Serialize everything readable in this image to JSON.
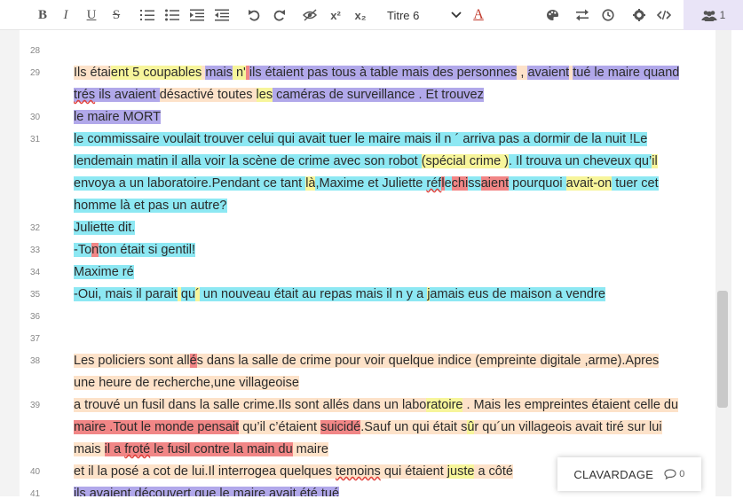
{
  "toolbar": {
    "bold_label": "B",
    "italic_label": "I",
    "underline_label": "U",
    "strike_label": "S",
    "superscript_label": "x²",
    "subscript_label": "x₂",
    "heading_select": {
      "value": "Titre 6"
    },
    "font_color_label": "A",
    "font_color": "#c0392b",
    "users_count": "1"
  },
  "gutter": {
    "line_numbers": [
      "28",
      "29",
      "30",
      "31",
      "32",
      "33",
      "34",
      "35",
      "36",
      "37",
      "38",
      "39",
      "40",
      "41"
    ]
  },
  "editor": {
    "lines": [
      {
        "segments": []
      },
      {
        "segments": [
          {
            "t": "Ils étai",
            "h": "p"
          },
          {
            "t": "ent 5 coupables",
            "h": "y"
          },
          {
            "t": " ",
            "h": "p"
          },
          {
            "t": "mais",
            "h": "v"
          },
          {
            "t": " n'",
            "h": "y"
          },
          {
            "t": " ",
            "h": "r"
          },
          {
            "t": "ils étaient pas tous à table mais des personnes",
            "h": "v"
          },
          {
            "t": " , ",
            "h": "p"
          },
          {
            "t": "avaient",
            "h": "v"
          },
          {
            "t": " ",
            "h": "p"
          },
          {
            "t": "tué le maire quand",
            "h": "v"
          }
        ]
      },
      {
        "segments": [
          {
            "t": "trés",
            "h": "v",
            "sp": true
          },
          {
            "t": " ils avaient ",
            "h": "v"
          },
          {
            "t": " désactivé toutes ",
            "h": "p"
          },
          {
            "t": "les",
            "h": "y"
          },
          {
            "t": " caméras de surveillance . Et trouvez",
            "h": "v"
          }
        ]
      },
      {
        "segments": [
          {
            "t": "le maire MORT",
            "h": "v"
          }
        ]
      },
      {
        "segments": [
          {
            "t": "le commissaire voulait trouver celui qui avait tuer le maire mais il n ´ arriva pas a dormir de la nuit !Le",
            "h": "c"
          }
        ]
      },
      {
        "segments": [
          {
            "t": "lendemain matin il alla voir la scène de crime avec son robot ",
            "h": "c"
          },
          {
            "t": "(spécial crime )",
            "h": "y"
          },
          {
            "t": ". Il trouva un cheveux qu’",
            "h": "c"
          },
          {
            "t": "il",
            "h": "y"
          }
        ]
      },
      {
        "segments": [
          {
            "t": "envoya a un  laboratoire.Pendant ce tant ",
            "h": "c"
          },
          {
            "t": "là",
            "h": "y"
          },
          {
            "t": ",Maxime et Juliette ",
            "h": "c"
          },
          {
            "t": "réf",
            "h": "c",
            "sp": true
          },
          {
            "t": "l",
            "h": "r"
          },
          {
            "t": "e",
            "h": "c"
          },
          {
            "t": "chi",
            "h": "r"
          },
          {
            "t": "ss",
            "h": "c"
          },
          {
            "t": "aient",
            "h": "r"
          },
          {
            "t": " pourquoi ",
            "h": "c"
          },
          {
            "t": "avait-on",
            "h": "y"
          },
          {
            "t": " tuer cet",
            "h": "c"
          }
        ]
      },
      {
        "segments": [
          {
            "t": "homme là et pas un autre?",
            "h": "c"
          }
        ]
      },
      {
        "segments": [
          {
            "t": "Juliette dit.",
            "h": "c"
          }
        ]
      },
      {
        "segments": [
          {
            "t": "-To",
            "h": "c"
          },
          {
            "t": "n",
            "h": "r"
          },
          {
            "t": "ton  était si gentil!",
            "h": "c"
          }
        ]
      },
      {
        "segments": [
          {
            "t": "Maxime ré",
            "h": "c"
          }
        ]
      },
      {
        "segments": [
          {
            "t": " -Oui, mais il parait",
            "h": "c"
          },
          {
            "t": " ",
            "h": "y"
          },
          {
            "t": "qu",
            "h": "c"
          },
          {
            "t": "´",
            "h": "y"
          },
          {
            "t": " un nouveau était au repas mais il n y a ",
            "h": "c"
          },
          {
            "t": "j",
            "h": "y"
          },
          {
            "t": "amais eus de maison a vendre",
            "h": "c"
          }
        ]
      },
      {
        "segments": []
      },
      {
        "segments": []
      },
      {
        "segments": [
          {
            "t": "Les policiers sont all",
            "h": "p"
          },
          {
            "t": "é",
            "h": "r"
          },
          {
            "t": "s dans la salle de crime pour voir quelque indice (empreinte digitale ,arme).Apres",
            "h": "p"
          }
        ]
      },
      {
        "segments": [
          {
            "t": "une heure de recherche,une villageoise",
            "h": "p"
          }
        ]
      },
      {
        "segments": [
          {
            "t": "a trouvé un fusil dans la salle crime.Ils sont allés dans un labo",
            "h": "p"
          },
          {
            "t": "ratoire",
            "h": "y"
          },
          {
            "t": " . Mais les empreintes étaient celle du",
            "h": "p"
          }
        ]
      },
      {
        "segments": [
          {
            "t": "maire .Tout le monde pensait",
            "h": "r"
          },
          {
            "t": " qu’il c’étaient ",
            "h": "p"
          },
          {
            "t": "suicidé",
            "h": "r"
          },
          {
            "t": ".Sauf un qui était s",
            "h": "p"
          },
          {
            "t": "û",
            "h": "y"
          },
          {
            "t": "r qu´un villageois avait tiré sur lui",
            "h": "p"
          }
        ]
      },
      {
        "segments": [
          {
            "t": "mais ",
            "h": "p"
          },
          {
            "t": "il a ",
            "h": "r"
          },
          {
            "t": "froté",
            "h": "r",
            "sp": true
          },
          {
            "t": " le fusil contre la main du",
            "h": "r"
          },
          {
            "t": " maire",
            "h": "p"
          }
        ]
      },
      {
        "segments": [
          {
            "t": " et il la posé a cot de lui.Il interrogea quelques ",
            "h": "p"
          },
          {
            "t": "temoins",
            "h": "p",
            "sp": true
          },
          {
            "t": " qui étaient ",
            "h": "p"
          },
          {
            "t": "juste",
            "h": "y"
          },
          {
            "t": " a côté",
            "h": "p"
          }
        ]
      },
      {
        "segments": [
          {
            "t": "ils avaient découvert que le maire avait été tué",
            "h": "v"
          }
        ]
      }
    ]
  },
  "chat": {
    "label": "CLAVARDAGE",
    "count": "0"
  }
}
